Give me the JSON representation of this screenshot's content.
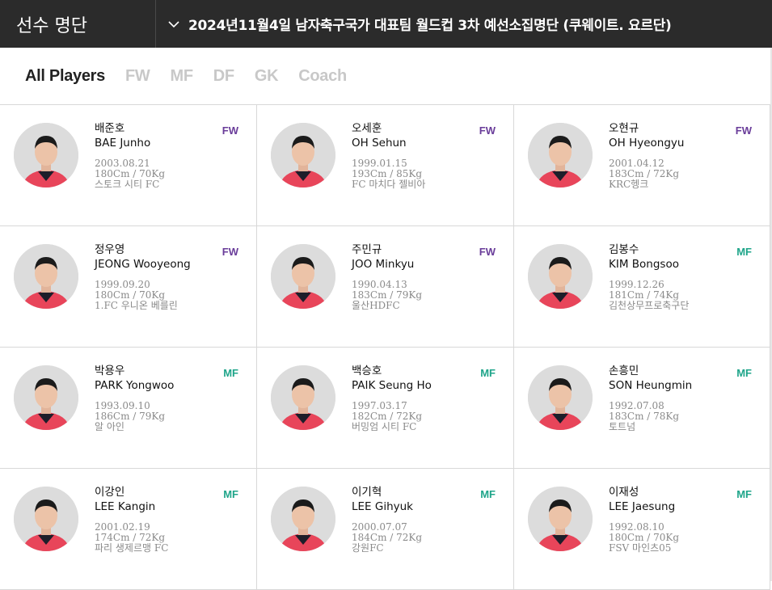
{
  "header": {
    "title": "선수 명단",
    "selected_squad": "2024년11월4일 남자축구국가 대표팀 월드컵 3차 예선소집명단 (쿠웨이트. 요르단)"
  },
  "filters": [
    "All Players",
    "FW",
    "MF",
    "DF",
    "GK",
    "Coach"
  ],
  "active_filter": "All Players",
  "colors": {
    "fw": "#6a3d9a",
    "mf": "#1fa58a",
    "header_bg": "#2b2b2b"
  },
  "players": [
    {
      "kname": "배준호",
      "ename": "BAE Junho",
      "pos": "FW",
      "birth": "2003.08.21",
      "body": "180Cm / 70Kg",
      "club": "스토크 시티 FC"
    },
    {
      "kname": "오세훈",
      "ename": "OH Sehun",
      "pos": "FW",
      "birth": "1999.01.15",
      "body": "193Cm / 85Kg",
      "club": "FC 마치다 젤비아"
    },
    {
      "kname": "오현규",
      "ename": "OH Hyeongyu",
      "pos": "FW",
      "birth": "2001.04.12",
      "body": "183Cm / 72Kg",
      "club": "KRC헹크"
    },
    {
      "kname": "정우영",
      "ename": "JEONG Wooyeong",
      "pos": "FW",
      "birth": "1999.09.20",
      "body": "180Cm / 70Kg",
      "club": "1.FC 우니온 베를린"
    },
    {
      "kname": "주민규",
      "ename": "JOO Minkyu",
      "pos": "FW",
      "birth": "1990.04.13",
      "body": "183Cm / 79Kg",
      "club": "울산HDFC"
    },
    {
      "kname": "김봉수",
      "ename": "KIM Bongsoo",
      "pos": "MF",
      "birth": "1999.12.26",
      "body": "181Cm / 74Kg",
      "club": "김천상무프로축구단"
    },
    {
      "kname": "박용우",
      "ename": "PARK Yongwoo",
      "pos": "MF",
      "birth": "1993.09.10",
      "body": "186Cm / 79Kg",
      "club": "알 아인"
    },
    {
      "kname": "백승호",
      "ename": "PAIK Seung Ho",
      "pos": "MF",
      "birth": "1997.03.17",
      "body": "182Cm / 72Kg",
      "club": "버밍엄 시티 FC"
    },
    {
      "kname": "손흥민",
      "ename": "SON Heungmin",
      "pos": "MF",
      "birth": "1992.07.08",
      "body": "183Cm / 78Kg",
      "club": "토트넘"
    },
    {
      "kname": "이강인",
      "ename": "LEE Kangin",
      "pos": "MF",
      "birth": "2001.02.19",
      "body": "174Cm / 72Kg",
      "club": "파리 생제르맹 FC"
    },
    {
      "kname": "이기혁",
      "ename": "LEE Gihyuk",
      "pos": "MF",
      "birth": "2000.07.07",
      "body": "184Cm / 72Kg",
      "club": "강원FC"
    },
    {
      "kname": "이재성",
      "ename": "LEE Jaesung",
      "pos": "MF",
      "birth": "1992.08.10",
      "body": "180Cm / 70Kg",
      "club": "FSV 마인츠05"
    }
  ]
}
